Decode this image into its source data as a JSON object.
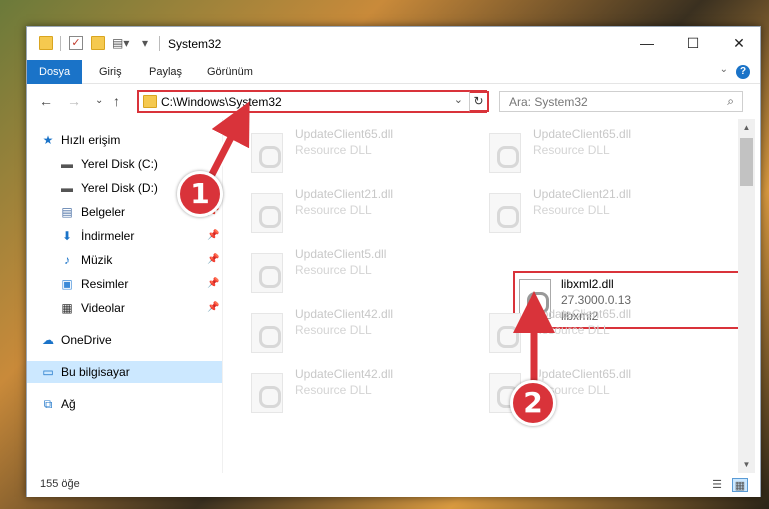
{
  "window": {
    "title": "System32"
  },
  "titlebar": {
    "minimize": "—",
    "maximize": "☐",
    "close": "✕"
  },
  "ribbon": {
    "tabs": [
      {
        "label": "Dosya"
      },
      {
        "label": "Giriş"
      },
      {
        "label": "Paylaş"
      },
      {
        "label": "Görünüm"
      }
    ],
    "help": "?",
    "expand": "⌄"
  },
  "nav": {
    "back": "←",
    "forward": "→",
    "recent": "⌄",
    "up": "↑",
    "address": "C:\\Windows\\System32",
    "refresh": "↻",
    "search_placeholder": "Ara: System32",
    "search_icon": "⌕"
  },
  "sidebar": {
    "items": [
      {
        "label": "Hızlı erişim",
        "icon": "★",
        "pinned": false
      },
      {
        "label": "Yerel Disk (C:)",
        "icon": "▬",
        "pinned": false
      },
      {
        "label": "Yerel Disk (D:)",
        "icon": "▬",
        "pinned": false
      },
      {
        "label": "Belgeler",
        "icon": "▤",
        "pinned": true
      },
      {
        "label": "İndirmeler",
        "icon": "⬇",
        "pinned": true
      },
      {
        "label": "Müzik",
        "icon": "♪",
        "pinned": true
      },
      {
        "label": "Resimler",
        "icon": "▣",
        "pinned": true
      },
      {
        "label": "Videolar",
        "icon": "▦",
        "pinned": true
      },
      {
        "label": "OneDrive",
        "icon": "☁",
        "pinned": false
      },
      {
        "label": "Bu bilgisayar",
        "icon": "▭",
        "pinned": false
      },
      {
        "label": "Ağ",
        "icon": "⧉",
        "pinned": false
      }
    ],
    "pin_glyph": "📌"
  },
  "files": [
    {
      "name": "UpdateClient65.dll",
      "desc": "Resource DLL"
    },
    {
      "name": "UpdateClient65.dll",
      "desc": "Resource DLL"
    },
    {
      "name": "UpdateClient21.dll",
      "desc": "Resource DLL"
    },
    {
      "name": "UpdateClient21.dll",
      "desc": "Resource DLL"
    },
    {
      "name": "UpdateClient5.dll",
      "desc": "Resource DLL"
    },
    {
      "name": "libxml2.dll",
      "desc": "27.3000.0.13",
      "extra": "libxml2"
    },
    {
      "name": "UpdateClient42.dll",
      "desc": "Resource DLL"
    },
    {
      "name": "UpdateClient65.dll",
      "desc": "Resource DLL"
    },
    {
      "name": "UpdateClient42.dll",
      "desc": "Resource DLL"
    },
    {
      "name": "UpdateClient65.dll",
      "desc": "Resource DLL"
    }
  ],
  "scrollbar": {
    "up": "▲",
    "down": "▼"
  },
  "status": {
    "count": "155 öğe"
  },
  "view_icons": {
    "details": "☰",
    "tiles": "▦"
  },
  "annotations": {
    "marker1": "1",
    "marker2": "2"
  },
  "colors": {
    "accent": "#1a73c8",
    "highlight": "#d9333a",
    "selected": "#cce8ff"
  }
}
